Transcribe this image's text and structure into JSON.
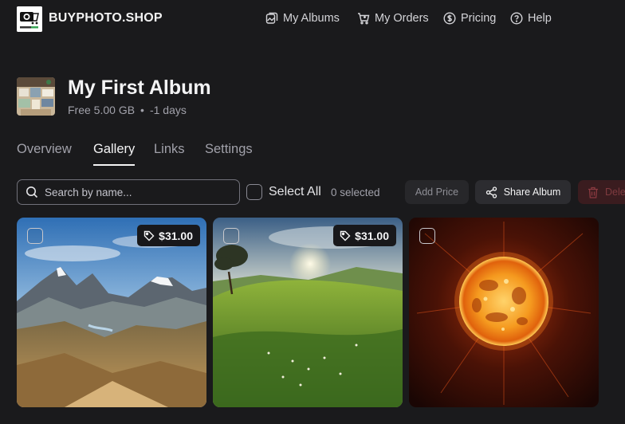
{
  "brand": {
    "name": "BUYPHOTO.SHOP",
    "logo_icon": "camera-cart-logo"
  },
  "nav": [
    {
      "label": "My Albums",
      "icon": "album-icon"
    },
    {
      "label": "My Orders",
      "icon": "cart-icon"
    },
    {
      "label": "Pricing",
      "icon": "dollar-circle-icon"
    },
    {
      "label": "Help",
      "icon": "question-circle-icon"
    }
  ],
  "album": {
    "title": "My First Album",
    "storage": "Free 5.00 GB",
    "separator": "•",
    "expiry": "-1 days"
  },
  "tabs": [
    {
      "label": "Overview",
      "active": false
    },
    {
      "label": "Gallery",
      "active": true
    },
    {
      "label": "Links",
      "active": false
    },
    {
      "label": "Settings",
      "active": false
    }
  ],
  "toolbar": {
    "search_placeholder": "Search by name...",
    "select_all_label": "Select All",
    "selected_count": "0 selected",
    "add_price_label": "Add Price",
    "share_label": "Share Album",
    "delete_label": "Delete"
  },
  "photos": [
    {
      "subject": "mountain-valley",
      "price": "$31.00"
    },
    {
      "subject": "grassy-hill-sunset",
      "price": "$31.00"
    },
    {
      "subject": "fiery-sun",
      "price": ""
    }
  ],
  "colors": {
    "background": "#1a1a1c",
    "text": "#e8e8ea",
    "muted": "#a1a1aa",
    "delete_bg": "#3a1c1f",
    "delete_text": "#7f3a3f"
  }
}
